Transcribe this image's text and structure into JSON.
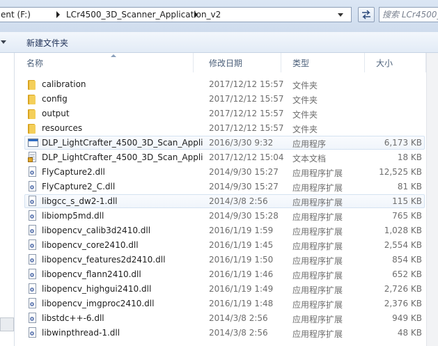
{
  "address_bar": {
    "crumbs": [
      "ent (F:)",
      "LCr4500_3D_Scanner_Application_v2"
    ],
    "search_placeholder": "搜索 LCr4500_3D_Sca"
  },
  "toolbar": {
    "new_folder_label": "新建文件夹"
  },
  "columns": {
    "name": "名称",
    "date": "修改日期",
    "type": "类型",
    "size": "大小"
  },
  "files": [
    {
      "name": "calibration",
      "date": "2017/12/12 15:57",
      "type": "文件夹",
      "size": "",
      "icon": "folder-icon"
    },
    {
      "name": "config",
      "date": "2017/12/12 15:57",
      "type": "文件夹",
      "size": "",
      "icon": "folder-icon"
    },
    {
      "name": "output",
      "date": "2017/12/12 15:57",
      "type": "文件夹",
      "size": "",
      "icon": "folder-icon"
    },
    {
      "name": "resources",
      "date": "2017/12/12 15:57",
      "type": "文件夹",
      "size": "",
      "icon": "folder-icon"
    },
    {
      "name": "DLP_LightCrafter_4500_3D_Scan_Appli...",
      "date": "2016/3/30 9:32",
      "type": "应用程序",
      "size": "6,173 KB",
      "icon": "exe-icon"
    },
    {
      "name": "DLP_LightCrafter_4500_3D_Scan_Appli...",
      "date": "2017/12/12 15:04",
      "type": "文本文档",
      "size": "18 KB",
      "icon": "text-file-icon"
    },
    {
      "name": "FlyCapture2.dll",
      "date": "2014/9/30 15:27",
      "type": "应用程序扩展",
      "size": "12,525 KB",
      "icon": "dll-file-icon"
    },
    {
      "name": "FlyCapture2_C.dll",
      "date": "2014/9/30 15:27",
      "type": "应用程序扩展",
      "size": "81 KB",
      "icon": "dll-file-icon"
    },
    {
      "name": "libgcc_s_dw2-1.dll",
      "date": "2014/3/8 2:56",
      "type": "应用程序扩展",
      "size": "115 KB",
      "icon": "dll-file-icon"
    },
    {
      "name": "libiomp5md.dll",
      "date": "2014/9/30 15:28",
      "type": "应用程序扩展",
      "size": "765 KB",
      "icon": "dll-file-icon"
    },
    {
      "name": "libopencv_calib3d2410.dll",
      "date": "2016/1/19 1:59",
      "type": "应用程序扩展",
      "size": "1,028 KB",
      "icon": "dll-file-icon"
    },
    {
      "name": "libopencv_core2410.dll",
      "date": "2016/1/19 1:45",
      "type": "应用程序扩展",
      "size": "2,554 KB",
      "icon": "dll-file-icon"
    },
    {
      "name": "libopencv_features2d2410.dll",
      "date": "2016/1/19 1:50",
      "type": "应用程序扩展",
      "size": "854 KB",
      "icon": "dll-file-icon"
    },
    {
      "name": "libopencv_flann2410.dll",
      "date": "2016/1/19 1:46",
      "type": "应用程序扩展",
      "size": "652 KB",
      "icon": "dll-file-icon"
    },
    {
      "name": "libopencv_highgui2410.dll",
      "date": "2016/1/19 1:49",
      "type": "应用程序扩展",
      "size": "2,726 KB",
      "icon": "dll-file-icon"
    },
    {
      "name": "libopencv_imgproc2410.dll",
      "date": "2016/1/19 1:48",
      "type": "应用程序扩展",
      "size": "2,376 KB",
      "icon": "dll-file-icon"
    },
    {
      "name": "libstdc++-6.dll",
      "date": "2014/3/8 2:56",
      "type": "应用程序扩展",
      "size": "949 KB",
      "icon": "dll-file-icon"
    },
    {
      "name": "libwinpthread-1.dll",
      "date": "2014/3/8 2:56",
      "type": "应用程序扩展",
      "size": "48 KB",
      "icon": "dll-file-icon"
    }
  ],
  "selected_rows": [
    4,
    8
  ]
}
